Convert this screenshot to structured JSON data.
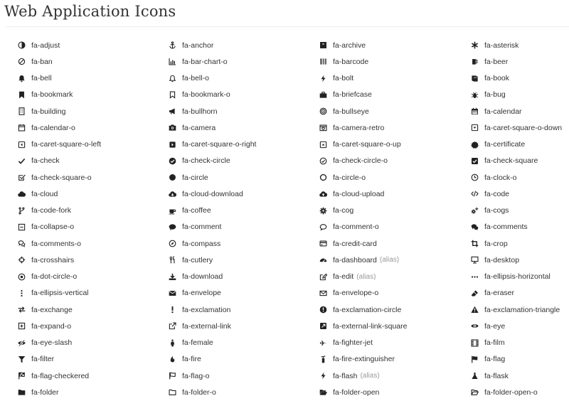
{
  "page": {
    "title": "Web Application Icons"
  },
  "icons": [
    {
      "label": "fa-adjust",
      "icon": "adjust"
    },
    {
      "label": "fa-anchor",
      "icon": "anchor"
    },
    {
      "label": "fa-archive",
      "icon": "archive"
    },
    {
      "label": "fa-asterisk",
      "icon": "asterisk"
    },
    {
      "label": "fa-ban",
      "icon": "ban"
    },
    {
      "label": "fa-bar-chart-o",
      "icon": "bar-chart-o"
    },
    {
      "label": "fa-barcode",
      "icon": "barcode"
    },
    {
      "label": "fa-beer",
      "icon": "beer"
    },
    {
      "label": "fa-bell",
      "icon": "bell"
    },
    {
      "label": "fa-bell-o",
      "icon": "bell-o"
    },
    {
      "label": "fa-bolt",
      "icon": "bolt"
    },
    {
      "label": "fa-book",
      "icon": "book"
    },
    {
      "label": "fa-bookmark",
      "icon": "bookmark"
    },
    {
      "label": "fa-bookmark-o",
      "icon": "bookmark-o"
    },
    {
      "label": "fa-briefcase",
      "icon": "briefcase"
    },
    {
      "label": "fa-bug",
      "icon": "bug"
    },
    {
      "label": "fa-building",
      "icon": "building"
    },
    {
      "label": "fa-bullhorn",
      "icon": "bullhorn"
    },
    {
      "label": "fa-bullseye",
      "icon": "bullseye"
    },
    {
      "label": "fa-calendar",
      "icon": "calendar"
    },
    {
      "label": "fa-calendar-o",
      "icon": "calendar-o"
    },
    {
      "label": "fa-camera",
      "icon": "camera"
    },
    {
      "label": "fa-camera-retro",
      "icon": "camera-retro"
    },
    {
      "label": "fa-caret-square-o-down",
      "icon": "caret-square-o-down"
    },
    {
      "label": "fa-caret-square-o-left",
      "icon": "caret-square-o-left"
    },
    {
      "label": "fa-caret-square-o-right",
      "icon": "caret-square-o-right"
    },
    {
      "label": "fa-caret-square-o-up",
      "icon": "caret-square-o-up"
    },
    {
      "label": "fa-certificate",
      "icon": "certificate"
    },
    {
      "label": "fa-check",
      "icon": "check"
    },
    {
      "label": "fa-check-circle",
      "icon": "check-circle"
    },
    {
      "label": "fa-check-circle-o",
      "icon": "check-circle-o"
    },
    {
      "label": "fa-check-square",
      "icon": "check-square"
    },
    {
      "label": "fa-check-square-o",
      "icon": "check-square-o"
    },
    {
      "label": "fa-circle",
      "icon": "circle"
    },
    {
      "label": "fa-circle-o",
      "icon": "circle-o"
    },
    {
      "label": "fa-clock-o",
      "icon": "clock-o"
    },
    {
      "label": "fa-cloud",
      "icon": "cloud"
    },
    {
      "label": "fa-cloud-download",
      "icon": "cloud-download"
    },
    {
      "label": "fa-cloud-upload",
      "icon": "cloud-upload"
    },
    {
      "label": "fa-code",
      "icon": "code"
    },
    {
      "label": "fa-code-fork",
      "icon": "code-fork"
    },
    {
      "label": "fa-coffee",
      "icon": "coffee"
    },
    {
      "label": "fa-cog",
      "icon": "cog"
    },
    {
      "label": "fa-cogs",
      "icon": "cogs"
    },
    {
      "label": "fa-collapse-o",
      "icon": "collapse-o"
    },
    {
      "label": "fa-comment",
      "icon": "comment"
    },
    {
      "label": "fa-comment-o",
      "icon": "comment-o"
    },
    {
      "label": "fa-comments",
      "icon": "comments"
    },
    {
      "label": "fa-comments-o",
      "icon": "comments-o"
    },
    {
      "label": "fa-compass",
      "icon": "compass"
    },
    {
      "label": "fa-credit-card",
      "icon": "credit-card"
    },
    {
      "label": "fa-crop",
      "icon": "crop"
    },
    {
      "label": "fa-crosshairs",
      "icon": "crosshairs"
    },
    {
      "label": "fa-cutlery",
      "icon": "cutlery"
    },
    {
      "label": "fa-dashboard",
      "alias": "(alias)",
      "icon": "dashboard"
    },
    {
      "label": "fa-desktop",
      "icon": "desktop"
    },
    {
      "label": "fa-dot-circle-o",
      "icon": "dot-circle-o"
    },
    {
      "label": "fa-download",
      "icon": "download"
    },
    {
      "label": "fa-edit",
      "alias": "(alias)",
      "icon": "edit"
    },
    {
      "label": "fa-ellipsis-horizontal",
      "icon": "ellipsis-horizontal"
    },
    {
      "label": "fa-ellipsis-vertical",
      "icon": "ellipsis-vertical"
    },
    {
      "label": "fa-envelope",
      "icon": "envelope"
    },
    {
      "label": "fa-envelope-o",
      "icon": "envelope-o"
    },
    {
      "label": "fa-eraser",
      "icon": "eraser"
    },
    {
      "label": "fa-exchange",
      "icon": "exchange"
    },
    {
      "label": "fa-exclamation",
      "icon": "exclamation"
    },
    {
      "label": "fa-exclamation-circle",
      "icon": "exclamation-circle"
    },
    {
      "label": "fa-exclamation-triangle",
      "icon": "exclamation-triangle"
    },
    {
      "label": "fa-expand-o",
      "icon": "expand-o"
    },
    {
      "label": "fa-external-link",
      "icon": "external-link"
    },
    {
      "label": "fa-external-link-square",
      "icon": "external-link-square"
    },
    {
      "label": "fa-eye",
      "icon": "eye"
    },
    {
      "label": "fa-eye-slash",
      "icon": "eye-slash"
    },
    {
      "label": "fa-female",
      "icon": "female"
    },
    {
      "label": "fa-fighter-jet",
      "icon": "fighter-jet"
    },
    {
      "label": "fa-film",
      "icon": "film"
    },
    {
      "label": "fa-filter",
      "icon": "filter"
    },
    {
      "label": "fa-fire",
      "icon": "fire"
    },
    {
      "label": "fa-fire-extinguisher",
      "icon": "fire-extinguisher"
    },
    {
      "label": "fa-flag",
      "icon": "flag"
    },
    {
      "label": "fa-flag-checkered",
      "icon": "flag-checkered"
    },
    {
      "label": "fa-flag-o",
      "icon": "flag-o"
    },
    {
      "label": "fa-flash",
      "alias": "(alias)",
      "icon": "flash"
    },
    {
      "label": "fa-flask",
      "icon": "flask"
    },
    {
      "label": "fa-folder",
      "icon": "folder"
    },
    {
      "label": "fa-folder-o",
      "icon": "folder-o"
    },
    {
      "label": "fa-folder-open",
      "icon": "folder-open"
    },
    {
      "label": "fa-folder-open-o",
      "icon": "folder-open-o"
    }
  ]
}
